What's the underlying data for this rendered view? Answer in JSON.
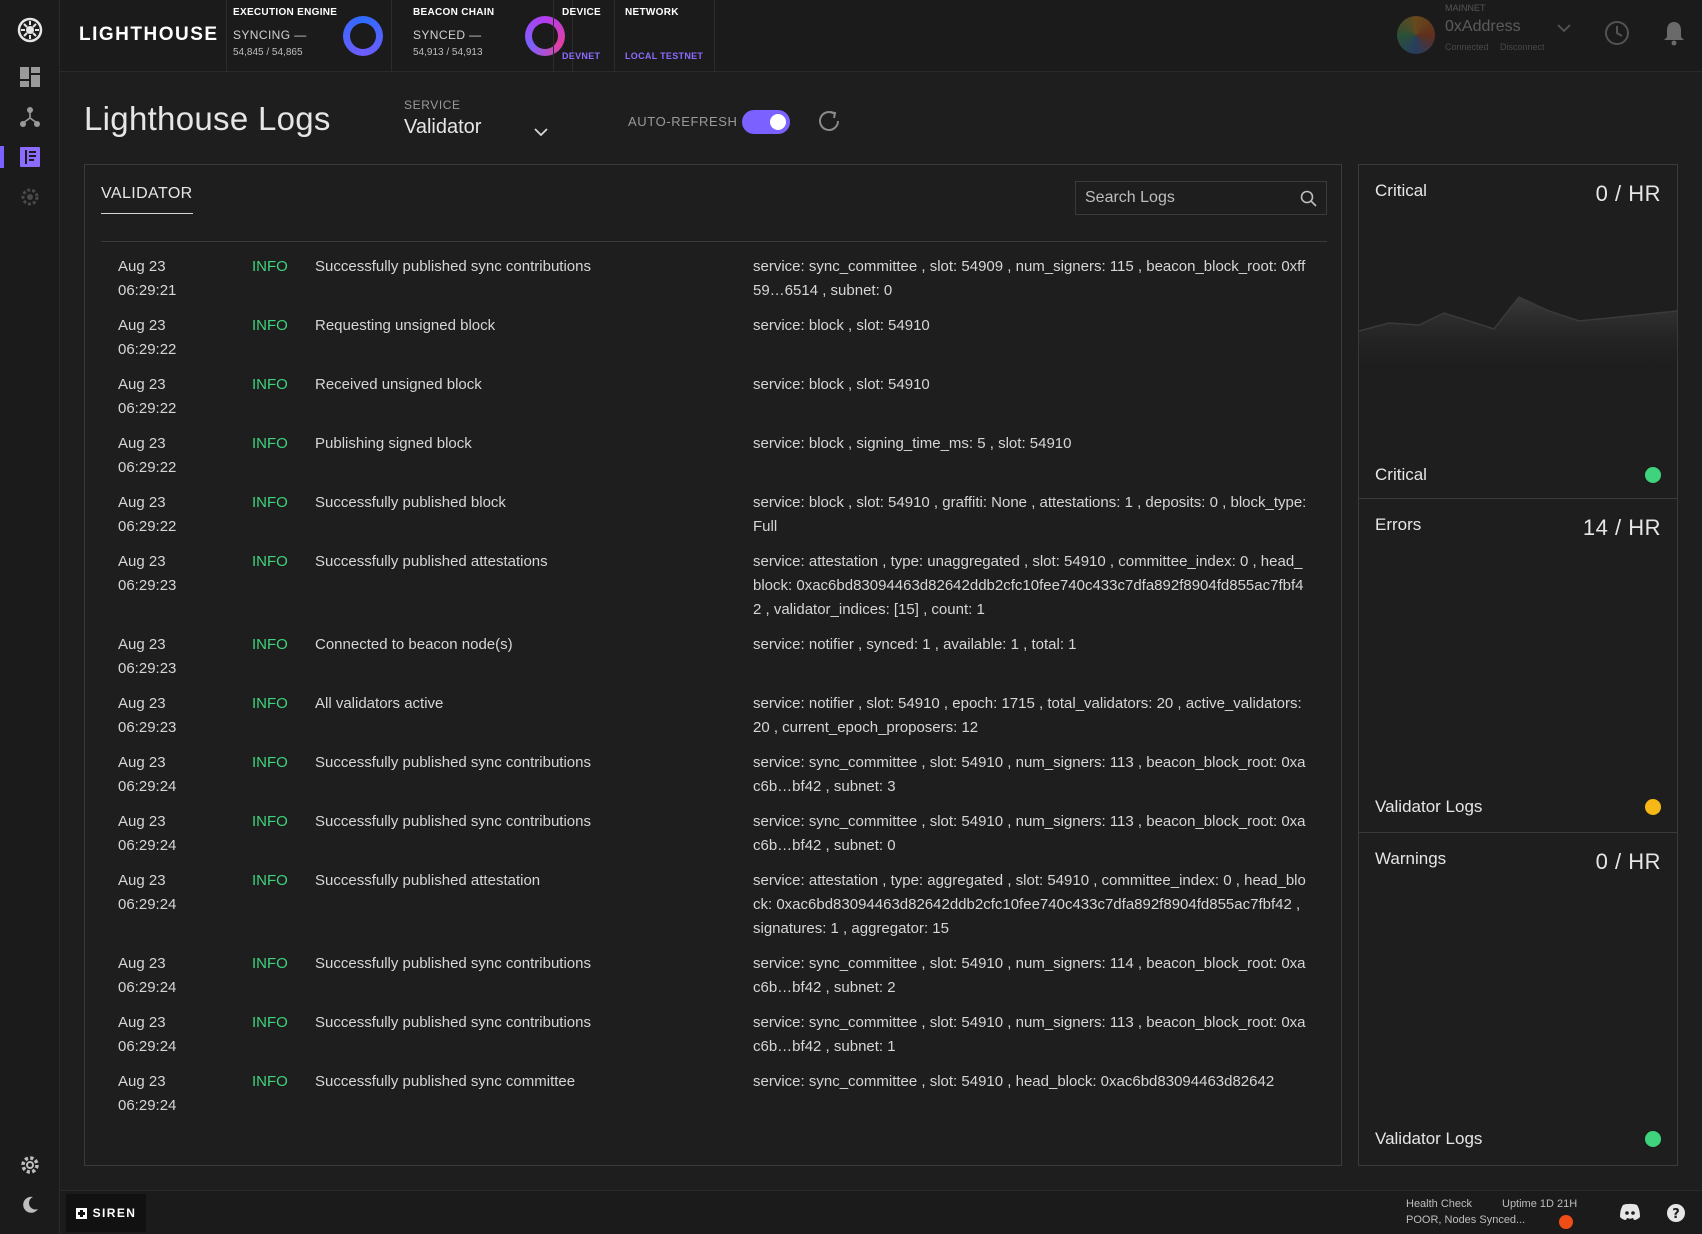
{
  "app": {
    "logo": "LIGHTHOUSE"
  },
  "nodes": {
    "execution": {
      "title": "EXECUTION ENGINE",
      "status": "SYNCING —",
      "count": "54,845 / 54,865"
    },
    "beacon": {
      "title": "BEACON CHAIN",
      "status": "SYNCED —",
      "count": "54,913 / 54,913"
    },
    "device": {
      "title": "DEVICE",
      "link": "DEVNET"
    },
    "network": {
      "title": "NETWORK",
      "link": "LOCAL TESTNET"
    }
  },
  "wallet": {
    "network": "MAINNET",
    "address": "0xAddress",
    "connected": "Connected",
    "disconnect": "Disconnect"
  },
  "header": {
    "title": "Lighthouse Logs",
    "service_label": "SERVICE",
    "service_value": "Validator",
    "auto_refresh_label": "AUTO-REFRESH",
    "auto_refresh_on": true
  },
  "logs": {
    "tab": "VALIDATOR",
    "search_placeholder": "Search Logs",
    "rows": [
      {
        "date": "Aug 23",
        "time": "06:29:21",
        "level": "INFO",
        "msg": "Successfully published sync contributions",
        "data": "service: sync_committee , slot: 54909 , num_signers: 115 , beacon_block_root: 0xff59…6514 , subnet: 0"
      },
      {
        "date": "Aug 23",
        "time": "06:29:22",
        "level": "INFO",
        "msg": "Requesting unsigned block",
        "data": "service: block , slot: 54910"
      },
      {
        "date": "Aug 23",
        "time": "06:29:22",
        "level": "INFO",
        "msg": "Received unsigned block",
        "data": "service: block , slot: 54910"
      },
      {
        "date": "Aug 23",
        "time": "06:29:22",
        "level": "INFO",
        "msg": "Publishing signed block",
        "data": "service: block , signing_time_ms: 5 , slot: 54910"
      },
      {
        "date": "Aug 23",
        "time": "06:29:22",
        "level": "INFO",
        "msg": "Successfully published block",
        "data": "service: block , slot: 54910 , graffiti: None , attestations: 1 , deposits: 0 , block_type: Full"
      },
      {
        "date": "Aug 23",
        "time": "06:29:23",
        "level": "INFO",
        "msg": "Successfully published attestations",
        "data": "service: attestation , type: unaggregated , slot: 54910 , committee_index: 0 , head_block: 0xac6bd83094463d82642ddb2cfc10fee740c433c7dfa892f8904fd855ac7fbf42 , validator_indices: [15] , count: 1"
      },
      {
        "date": "Aug 23",
        "time": "06:29:23",
        "level": "INFO",
        "msg": "Connected to beacon node(s)",
        "data": "service: notifier , synced: 1 , available: 1 , total: 1"
      },
      {
        "date": "Aug 23",
        "time": "06:29:23",
        "level": "INFO",
        "msg": "All validators active",
        "data": "service: notifier , slot: 54910 , epoch: 1715 , total_validators: 20 , active_validators: 20 , current_epoch_proposers: 12"
      },
      {
        "date": "Aug 23",
        "time": "06:29:24",
        "level": "INFO",
        "msg": "Successfully published sync contributions",
        "data": "service: sync_committee , slot: 54910 , num_signers: 113 , beacon_block_root: 0xac6b…bf42 , subnet: 3"
      },
      {
        "date": "Aug 23",
        "time": "06:29:24",
        "level": "INFO",
        "msg": "Successfully published sync contributions",
        "data": "service: sync_committee , slot: 54910 , num_signers: 113 , beacon_block_root: 0xac6b…bf42 , subnet: 0"
      },
      {
        "date": "Aug 23",
        "time": "06:29:24",
        "level": "INFO",
        "msg": "Successfully published attestation",
        "data": "service: attestation , type: aggregated , slot: 54910 , committee_index: 0 , head_block: 0xac6bd83094463d82642ddb2cfc10fee740c433c7dfa892f8904fd855ac7fbf42 , signatures: 1 , aggregator: 15"
      },
      {
        "date": "Aug 23",
        "time": "06:29:24",
        "level": "INFO",
        "msg": "Successfully published sync contributions",
        "data": "service: sync_committee , slot: 54910 , num_signers: 114 , beacon_block_root: 0xac6b…bf42 , subnet: 2"
      },
      {
        "date": "Aug 23",
        "time": "06:29:24",
        "level": "INFO",
        "msg": "Successfully published sync contributions",
        "data": "service: sync_committee , slot: 54910 , num_signers: 113 , beacon_block_root: 0xac6b…bf42 , subnet: 1"
      },
      {
        "date": "Aug 23",
        "time": "06:29:24",
        "level": "INFO",
        "msg": "Successfully published sync committee",
        "data": "service: sync_committee , slot: 54910 , head_block: 0xac6bd83094463d82642"
      }
    ]
  },
  "stats": [
    {
      "title": "Critical",
      "rate": "0 / HR",
      "footer": "Critical",
      "dot_color": "#3ed37c",
      "sparkline": true
    },
    {
      "title": "Errors",
      "rate": "14 / HR",
      "footer": "Validator Logs",
      "dot_color": "#f6b816",
      "sparkline": false
    },
    {
      "title": "Warnings",
      "rate": "0 / HR",
      "footer": "Validator Logs",
      "dot_color": "#3ed37c",
      "sparkline": false
    }
  ],
  "footer": {
    "siren_label": "SIREN",
    "health_check_label": "Health Check",
    "health_status": "POOR, Nodes Synced...",
    "uptime": "Uptime 1D 21H",
    "health_dot_color": "#ef4d16"
  },
  "colors": {
    "accent": "#7b61ff",
    "info": "#3ed37c",
    "background": "#1e1e1e"
  },
  "icons": {
    "rail": [
      "siren-logo-icon",
      "dashboard-icon",
      "validators-icon",
      "logs-icon",
      "settings-gear-icon",
      "settings-icon",
      "moon-icon"
    ],
    "top": [
      "history-clock-icon",
      "bell-icon"
    ],
    "footer": [
      "discord-icon",
      "help-icon"
    ]
  }
}
